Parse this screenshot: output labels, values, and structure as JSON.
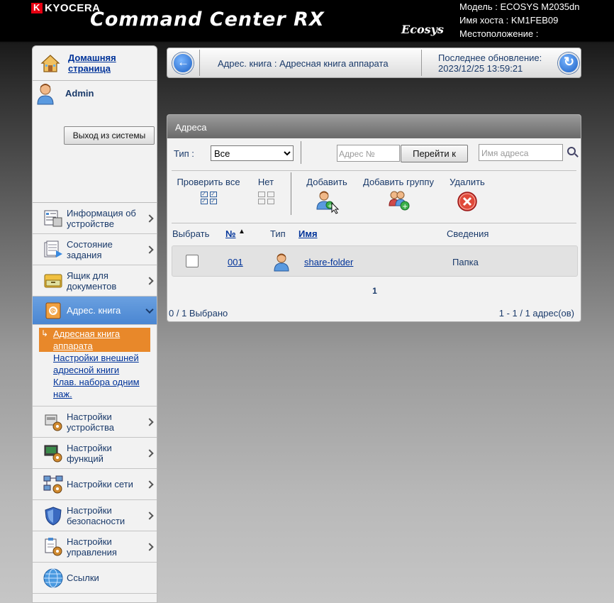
{
  "header": {
    "brand": "KYOCERA",
    "title": "Command Center RX",
    "sub_brand": "Ecosys",
    "model": "Модель : ECOSYS M2035dn",
    "host": "Имя хоста : KM1FEB09",
    "location": "Местоположение :"
  },
  "sidebar": {
    "home": "Домашняя страница",
    "user": "Admin",
    "logout": "Выход из системы",
    "items": [
      {
        "label": "Информация об устройстве"
      },
      {
        "label": "Состояние задания"
      },
      {
        "label": "Ящик для документов"
      },
      {
        "label": "Адрес. книга"
      },
      {
        "label": "Настройки устройства"
      },
      {
        "label": "Настройки функций"
      },
      {
        "label": "Настройки сети"
      },
      {
        "label": "Настройки безопасности"
      },
      {
        "label": "Настройки управления"
      },
      {
        "label": "Ссылки"
      }
    ],
    "submenu": [
      "Адресная книга аппарата",
      "Настройки внешней адресной книги",
      "Клав. набора одним наж."
    ]
  },
  "topbar": {
    "breadcrumb": "Адрес. книга : Адресная книга аппарата",
    "last_update_label": "Последнее обновление:",
    "last_update_value": "2023/12/25 13:59:21"
  },
  "panel": {
    "title": "Адреса",
    "type_label": "Тип :",
    "type_value": "Все",
    "address_no_placeholder": "Адрес №",
    "goto": "Перейти к",
    "name_placeholder": "Имя адреса",
    "actions": {
      "check_all": "Проверить все",
      "none": "Нет",
      "add": "Добавить",
      "add_group": "Добавить группу",
      "delete": "Удалить"
    },
    "columns": {
      "select": "Выбрать",
      "number": "№",
      "type": "Тип",
      "name": "Имя",
      "details": "Сведения"
    },
    "rows": [
      {
        "number": "001",
        "name": "share-folder",
        "details": "Папка"
      }
    ],
    "page": "1",
    "selected": "0 / 1 Выбрано",
    "range": "1 - 1 / 1 адрес(ов)"
  }
}
